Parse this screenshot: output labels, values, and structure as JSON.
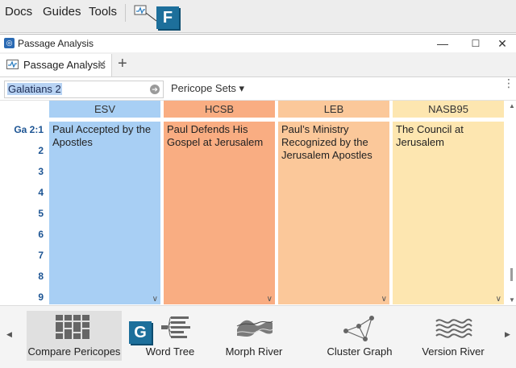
{
  "menu": {
    "items": [
      "Docs",
      "Guides",
      "Tools"
    ]
  },
  "callouts": {
    "top": "F",
    "bottom": "G"
  },
  "window": {
    "title": "Passage Analysis",
    "minimize": "—",
    "maximize": "☐",
    "close": "✕"
  },
  "tabs": [
    {
      "label": "Passage Analysis",
      "close": "✕"
    }
  ],
  "new_tab": "+",
  "toolbar": {
    "reference": "Galatians 2",
    "go_icon": "➔",
    "pericope_sets": "Pericope Sets ▾",
    "more": "⋮"
  },
  "verses": [
    "Ga 2:1",
    "2",
    "3",
    "4",
    "5",
    "6",
    "7",
    "8",
    "9"
  ],
  "columns": [
    {
      "version": "ESV",
      "header_color": "#a8cff4",
      "body_color": "#a8cff4",
      "pericope": "Paul Accepted by the Apostles"
    },
    {
      "version": "HCSB",
      "header_color": "#f9ad82",
      "body_color": "#f9ad82",
      "pericope": "Paul Defends His Gospel at Jerusalem"
    },
    {
      "version": "LEB",
      "header_color": "#fbc89a",
      "body_color": "#fbc89a",
      "pericope": "Paul’s Ministry Recognized by the Jerusalem Apostles"
    },
    {
      "version": "NASB95",
      "header_color": "#fde6b0",
      "body_color": "#fde6b0",
      "pericope": "The Council at Jerusalem"
    }
  ],
  "chevron": "∨",
  "gallery": {
    "prev": "◀",
    "next": "▶",
    "tools": [
      {
        "label": "Compare Pericopes",
        "selected": true,
        "icon": "compare-pericopes-icon"
      },
      {
        "label": "Word Tree",
        "selected": false,
        "icon": "word-tree-icon"
      },
      {
        "label": "Morph River",
        "selected": false,
        "icon": "morph-river-icon"
      },
      {
        "label": "Cluster Graph",
        "selected": false,
        "icon": "cluster-graph-icon"
      },
      {
        "label": "Version River",
        "selected": false,
        "icon": "version-river-icon"
      }
    ]
  }
}
